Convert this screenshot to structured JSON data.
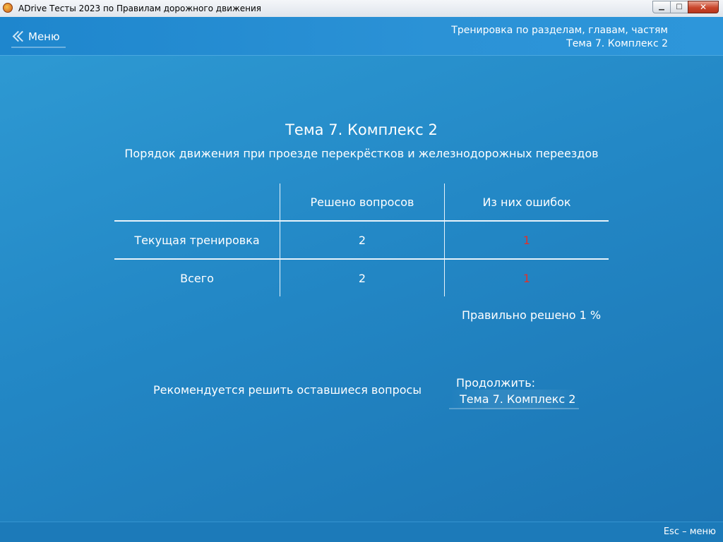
{
  "window": {
    "title": "ADrive Тесты 2023 по Правилам дорожного движения",
    "minimize_symbol": "▁",
    "maximize_symbol": "□",
    "close_symbol": "✕"
  },
  "header": {
    "menu_label": "Меню",
    "breadcrumb_line1": "Тренировка по разделам, главам, частям",
    "breadcrumb_line2": "Тема 7. Комплекс 2"
  },
  "main": {
    "title": "Тема 7. Комплекс 2",
    "subtitle": "Порядок движения при проезде перекрёстков и железнодорожных переездов",
    "table": {
      "col_solved": "Решено вопросов",
      "col_errors": "Из них ошибок",
      "rows": [
        {
          "label": "Текущая тренировка",
          "solved": "2",
          "errors": "1"
        },
        {
          "label": "Всего",
          "solved": "2",
          "errors": "1"
        }
      ]
    },
    "percent_text": "Правильно решено 1 %",
    "recommendation": "Рекомендуется решить оставшиеся вопросы",
    "continue_label": "Продолжить:",
    "continue_target": "Тема 7. Комплекс 2"
  },
  "footer": {
    "hint": "Esc – меню"
  },
  "colors": {
    "error": "#e0312b",
    "accent": "#2388c6"
  }
}
